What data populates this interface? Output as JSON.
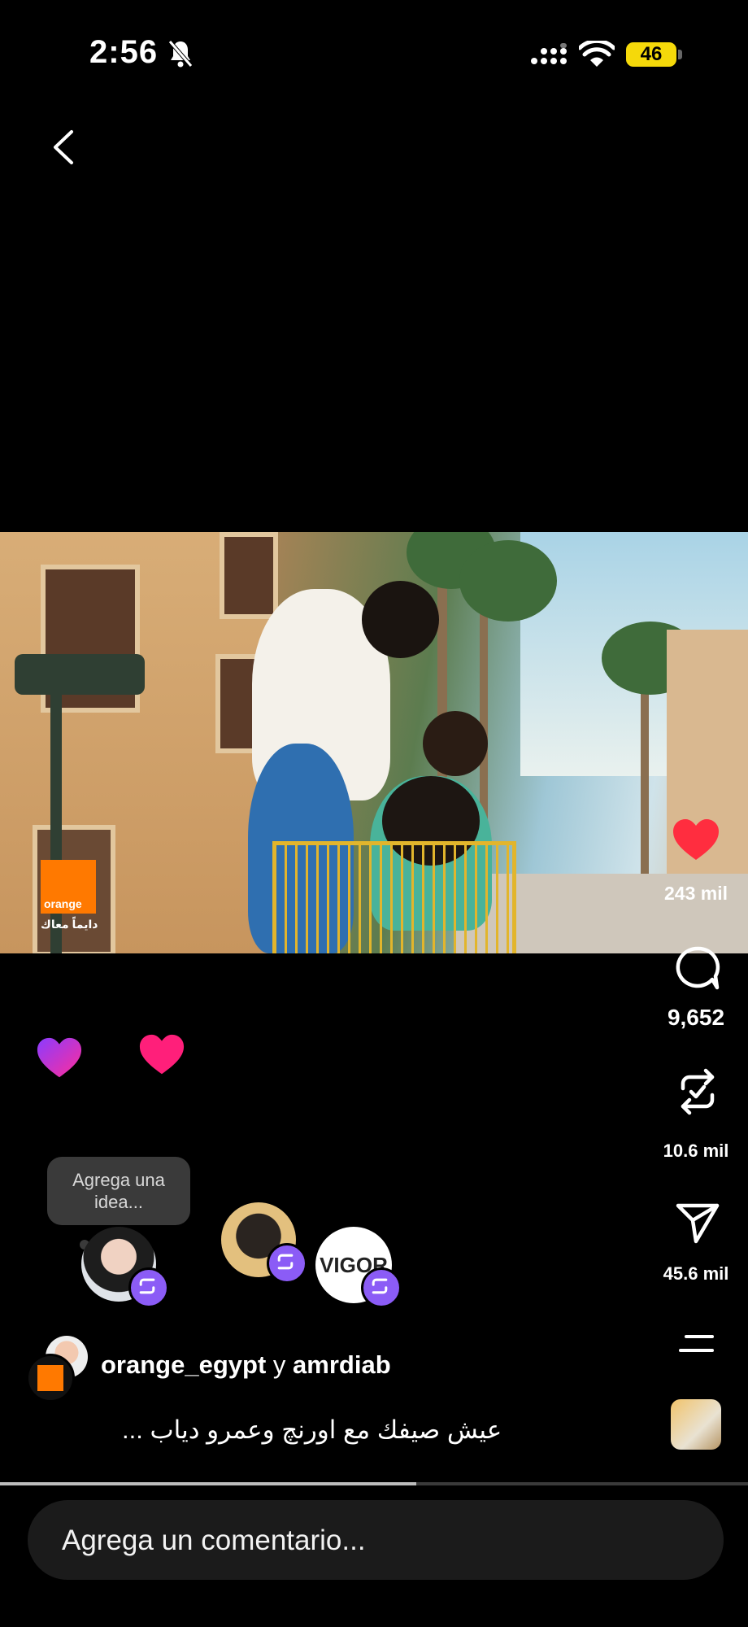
{
  "status_bar": {
    "time": "2:56",
    "battery": "46",
    "icons": [
      "bell-slash-icon",
      "signal-icon",
      "wifi-icon",
      "battery-icon"
    ]
  },
  "nav": {
    "back_icon": "chevron-left-icon"
  },
  "video": {
    "brand_logo_text": "orange",
    "brand_tagline": "دايماً معاك",
    "progress": 0.557
  },
  "rail": {
    "likes": "243 mil",
    "comments": "9,652",
    "reposts": "10.6 mil",
    "shares": "45.6 mil",
    "icons": [
      "heart-icon",
      "comment-icon",
      "repost-icon",
      "send-icon",
      "menu-icon"
    ]
  },
  "idea_bubble": {
    "text": "Agrega una idea..."
  },
  "reposters": [
    {
      "name": "woman-avatar"
    },
    {
      "name": "man-avatar"
    },
    {
      "name": "vigor-avatar",
      "label": "VIGOR"
    }
  ],
  "post": {
    "user1": "orange_egypt",
    "joiner": "y",
    "user2": "amrdiab",
    "caption": "عيش صيفك مع اورنچ وعمرو دياب ..."
  },
  "comment_input": {
    "placeholder": "Agrega un comentario..."
  },
  "colors": {
    "like_red": "#ff2d3f",
    "repost_purple": "#8b5cf6",
    "battery_yellow": "#f5d90a",
    "orange_brand": "#ff7900"
  }
}
